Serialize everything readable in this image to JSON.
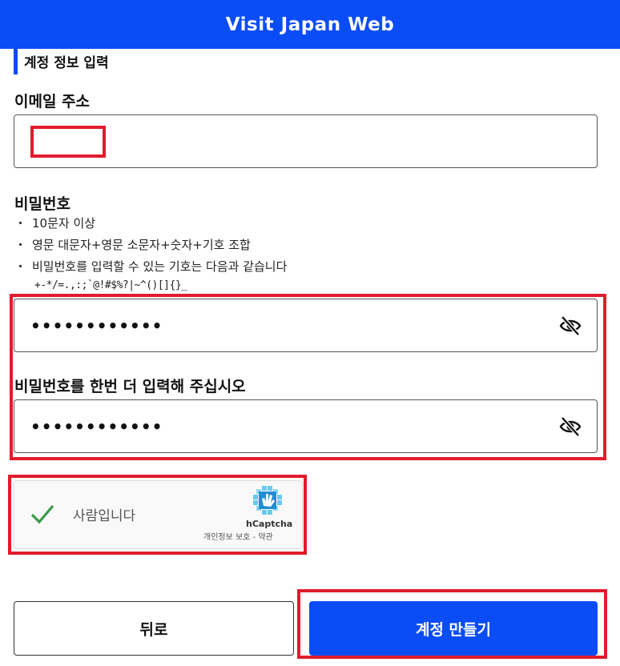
{
  "header": {
    "title": "Visit Japan Web"
  },
  "section": {
    "title": "계정 정보 입력"
  },
  "email": {
    "label": "이메일 주소",
    "value": ""
  },
  "password": {
    "label": "비밀번호",
    "rules": [
      "10문자 이상",
      "영문 대문자+영문 소문자+숫자+기호 조합",
      "비밀번호를 입력할 수 있는 기호는 다음과 같습니다"
    ],
    "bullet": "・",
    "symbols": "+-*/=.,:;`@!#$%?|~^()[]{}_",
    "masked_value": "••••••••••••",
    "toggle_icon": "eye-slash-icon"
  },
  "password_confirm": {
    "label": "비밀번호를 한번 더 입력해 주십시오",
    "masked_value": "••••••••••••",
    "toggle_icon": "eye-slash-icon"
  },
  "captcha": {
    "status_text": "사람입니다",
    "checked": true,
    "brand": "hCaptcha",
    "terms": "개인정보 보호 - 약관"
  },
  "buttons": {
    "back_label": "뒤로",
    "create_label": "계정 만들기"
  },
  "colors": {
    "primary": "#0a4cf6",
    "highlight": "#e01c2c",
    "check": "#3a9a4a"
  }
}
